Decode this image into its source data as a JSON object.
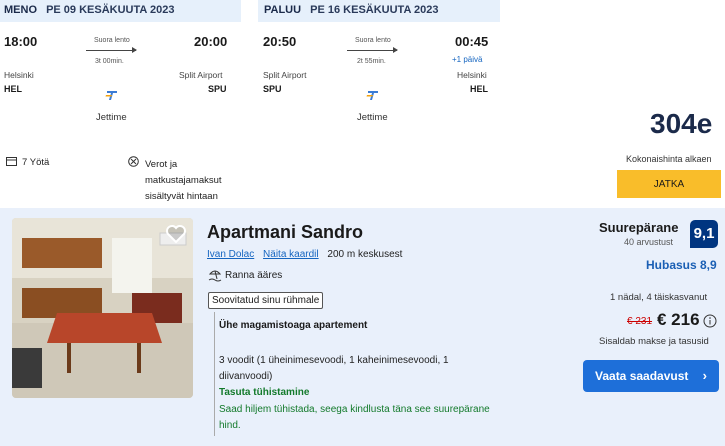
{
  "outbound": {
    "header_key": "MENO",
    "header_date": "PE 09 KESÄKUUTA 2023",
    "depart_time": "18:00",
    "arrive_time": "20:00",
    "direct_label": "Suora lento",
    "duration": "3t 00min.",
    "depart_city": "Helsinki",
    "depart_code": "HEL",
    "arrive_city": "Split Airport",
    "arrive_code": "SPU",
    "airline": "Jettime"
  },
  "return": {
    "header_key": "PALUU",
    "header_date": "PE 16 KESÄKUUTA 2023",
    "depart_time": "20:50",
    "arrive_time": "00:45",
    "direct_label": "Suora lento",
    "duration": "2t 55min.",
    "next_day": "+1 päivä",
    "depart_city": "Split Airport",
    "depart_code": "SPU",
    "arrive_city": "Helsinki",
    "arrive_code": "HEL",
    "airline": "Jettime"
  },
  "extras": {
    "nights": "7 Yötä",
    "taxes_line1": "Verot ja",
    "taxes_line2": "matkustajamaksut",
    "taxes_line3": "sisältyvät hintaan"
  },
  "package": {
    "price": "304e",
    "price_label": "Kokonaishinta alkaen",
    "continue_label": "JATKA"
  },
  "hotel": {
    "name": "Apartmani Sandro",
    "location_link": "Ivan Dolac",
    "map_link": "Näita kaardil",
    "distance": "200 m keskusest",
    "beach": "Ranna ääres",
    "tag": "Soovitatud sinu rühmale",
    "room_type": "Ühe magamistoaga apartement",
    "beds_line1": "3 voodit (1 üheinimesevoodi, 1 kaheinimesevoodi, 1",
    "beds_line2": "diivanvoodi)",
    "free_cancel": "Tasuta tühistamine",
    "cancel_line1": "Saad hiljem tühistada, seega kindlusta täna see suurepärane",
    "cancel_line2": "hind.",
    "rating_word": "Suurepärane",
    "reviews": "40 arvustust",
    "score": "9,1",
    "value_label": "Hubasus 8,9",
    "stay_info": "1 nädal, 4 täiskasvanut",
    "old_price": "€ 231",
    "new_price": "€ 216",
    "taxes_note": "Sisaldab makse ja tasusid",
    "view_button": "Vaata saadavust"
  },
  "colors": {
    "header_bg": "#e6f0fb",
    "hotel_bg": "#e9f0fb",
    "accent_yellow": "#f9bd2a",
    "brand_blue": "#003580",
    "button_blue": "#1e6fd9",
    "green": "#137a2b",
    "old_price_red": "#cc0000"
  }
}
